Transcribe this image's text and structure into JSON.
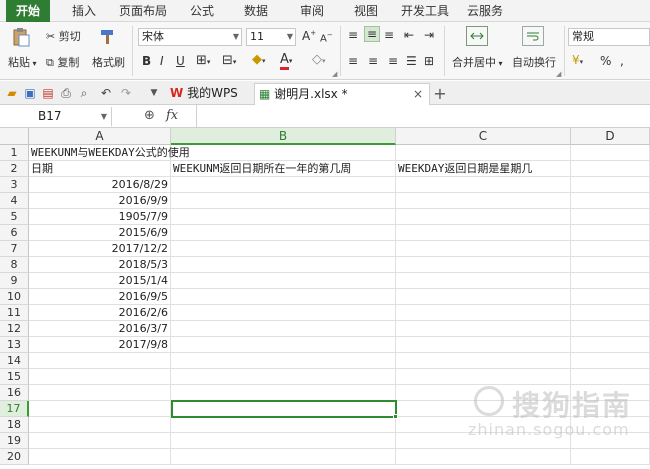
{
  "ribbon_tabs": [
    "开始",
    "插入",
    "页面布局",
    "公式",
    "数据",
    "审阅",
    "视图",
    "开发工具",
    "云服务"
  ],
  "active_tab_color": "#2e7d32",
  "clipboard": {
    "paste": "粘贴",
    "cut": "剪切",
    "copy": "复制",
    "format_painter": "格式刷"
  },
  "font": {
    "name": "宋体",
    "size": "11"
  },
  "alignment": {
    "merge_center": "合并居中",
    "wrap_text": "自动换行"
  },
  "number_format": {
    "current": "常规",
    "percent": "%"
  },
  "quick_access": {
    "other_tab_label": ""
  },
  "doc_tabs": [
    {
      "label": "我的WPS"
    },
    {
      "label": "谢明月.xlsx *"
    }
  ],
  "new_tab": "+",
  "close_tab": "×",
  "formula_bar": {
    "cell_ref": "B17",
    "fx": "fx",
    "content": ""
  },
  "columns": [
    "A",
    "B",
    "C",
    "D"
  ],
  "rows": [
    "1",
    "2",
    "3",
    "4",
    "5",
    "6",
    "7",
    "8",
    "9",
    "10",
    "11",
    "12",
    "13",
    "14",
    "15",
    "16",
    "17",
    "18",
    "19",
    "20"
  ],
  "selected_cell": "B17",
  "cells": {
    "A1": "WEEKUNM与WEEKDAY公式的使用",
    "A2": "日期",
    "B2": "WEEKUNM返回日期所在一年的第几周",
    "C2": "WEEKDAY返回日期是星期几",
    "A3": "2016/8/29",
    "A4": "2016/9/9",
    "A5": "1905/7/9",
    "A6": "2015/6/9",
    "A7": "2017/12/2",
    "A8": "2018/5/3",
    "A9": "2015/1/4",
    "A10": "2016/9/5",
    "A11": "2016/2/6",
    "A12": "2016/3/7",
    "A13": "2017/9/8"
  },
  "watermark": {
    "text": "搜狗指南",
    "sub": "zhinan.sogou.com"
  }
}
